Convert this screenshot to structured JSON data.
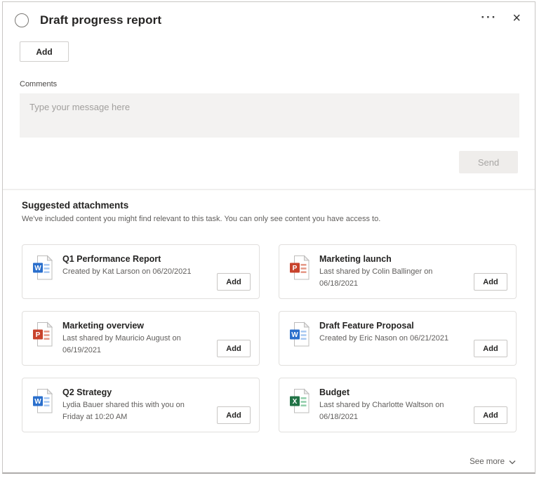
{
  "header": {
    "title": "Draft progress report",
    "ellipsis_icon": "···",
    "close_icon": "×"
  },
  "toolbar": {
    "add_label": "Add"
  },
  "comments": {
    "label": "Comments",
    "placeholder": "Type your message here",
    "value": "",
    "send_label": "Send"
  },
  "suggestions": {
    "title": "Suggested attachments",
    "subtitle": "We've included content you might find relevant to this task. You can only see content you have access to.",
    "see_more_label": "See more",
    "cards": [
      {
        "title": "Q1 Performance Report",
        "meta": "Created by Kat Larson on 06/20/2021",
        "file_type": "word",
        "add_label": "Add"
      },
      {
        "title": "Marketing launch",
        "meta": "Last shared by Colin Ballinger on 06/18/2021",
        "file_type": "powerpoint",
        "add_label": "Add"
      },
      {
        "title": "Marketing overview",
        "meta": "Last shared by Mauricio August on 06/19/2021",
        "file_type": "powerpoint",
        "add_label": "Add"
      },
      {
        "title": "Draft Feature Proposal",
        "meta": "Created by Eric Nason on 06/21/2021",
        "file_type": "word",
        "add_label": "Add"
      },
      {
        "title": "Q2 Strategy",
        "meta": "Lydia Bauer shared this with you on Friday at 10:20 AM",
        "file_type": "word",
        "add_label": "Add"
      },
      {
        "title": "Budget",
        "meta": "Last shared by Charlotte Waltson on 06/18/2021",
        "file_type": "excel",
        "add_label": "Add"
      }
    ]
  },
  "file_icons": {
    "word": {
      "letter": "W",
      "color": "#2a6fcc",
      "light": "#a9c9f2"
    },
    "powerpoint": {
      "letter": "P",
      "color": "#c8432c",
      "light": "#e59a89"
    },
    "excel": {
      "letter": "X",
      "color": "#217346",
      "light": "#93cfac"
    }
  },
  "colors": {
    "card_border": "#e1dfdd",
    "comment_bg": "#f3f2f1",
    "disabled_button_bg": "#efedeb",
    "text_primary": "#252423",
    "text_secondary": "#605e5c"
  }
}
